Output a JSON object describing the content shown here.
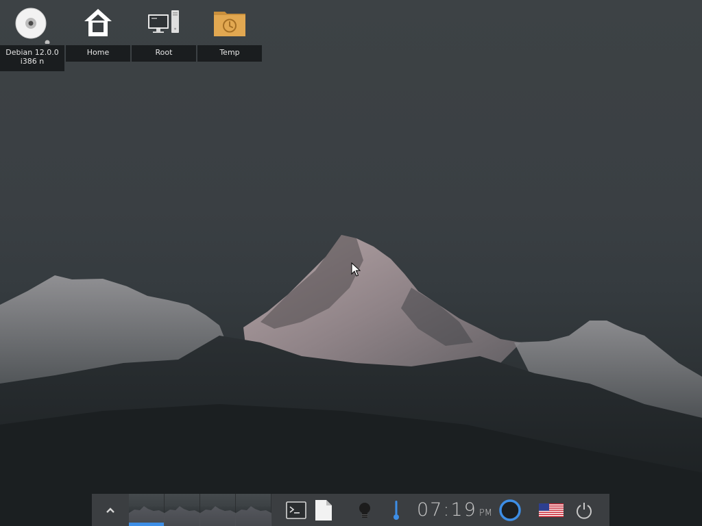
{
  "desktop_icons": [
    {
      "name": "debian-disc",
      "label_line1": "Debian 12.0.0",
      "label_line2": "i386 n",
      "icon": "disc-icon"
    },
    {
      "name": "home",
      "label": "Home",
      "icon": "home-icon"
    },
    {
      "name": "root",
      "label": "Root",
      "icon": "computer-icon"
    },
    {
      "name": "temp",
      "label": "Temp",
      "icon": "folder-clock-icon"
    }
  ],
  "taskbar": {
    "show_launcher_icon": "chevron-up-icon",
    "workspaces": [
      {
        "name": "workspace-1",
        "active": true
      },
      {
        "name": "workspace-2",
        "active": false
      },
      {
        "name": "workspace-3",
        "active": false
      },
      {
        "name": "workspace-4",
        "active": false
      }
    ],
    "launchers": [
      "terminal-icon",
      "file-icon"
    ],
    "tray": [
      "bulb-icon",
      "thermometer-icon"
    ],
    "clock": {
      "time": "07:19",
      "ampm": "PM"
    },
    "status_ring_icon": "ring-icon",
    "keyboard_layout_icon": "us-flag-icon",
    "power_icon": "power-icon"
  },
  "colors": {
    "accent": "#3d8ee6",
    "taskbar_bg": "#3b3e41",
    "label_bg": "#141719",
    "folder": "#d9a24a"
  }
}
